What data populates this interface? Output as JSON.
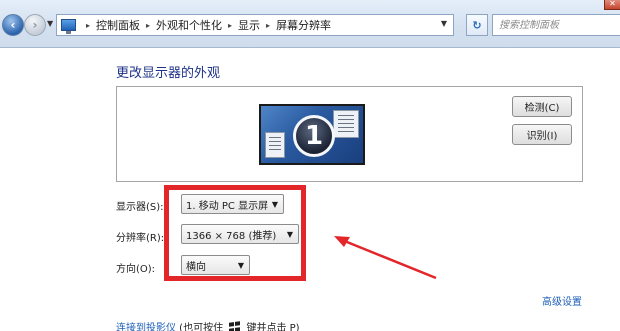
{
  "window": {
    "close_glyph": "✕"
  },
  "nav": {
    "back_glyph": "‹",
    "forward_glyph": "›",
    "dropdown_glyph": "▼"
  },
  "address_bar": {
    "icon": "control-panel-icon",
    "breadcrumbs": [
      {
        "label": "控制面板"
      },
      {
        "label": "外观和个性化"
      },
      {
        "label": "显示"
      },
      {
        "label": "屏幕分辨率"
      }
    ],
    "separator_glyph": "▸",
    "dropdown_glyph": "▼",
    "refresh_glyph": "↻"
  },
  "search": {
    "placeholder": "搜索控制面板"
  },
  "main": {
    "title": "更改显示器的外观",
    "monitor_number": "1",
    "detect_button": "检测(C)",
    "identify_button": "识别(I)",
    "display_label": "显示器(S):",
    "display_value": "1. 移动 PC 显示屏",
    "resolution_label": "分辨率(R):",
    "resolution_value": "1366 × 768 (推荐)",
    "orientation_label": "方向(O):",
    "orientation_value": "横向",
    "combo_arrow": "▼",
    "advanced_link": "高级设置",
    "projector_link": "连接到投影仪",
    "projector_hint_prefix": " (也可按住 ",
    "projector_hint_suffix": " 键并点击 P)"
  },
  "annotation": {
    "highlight_color": "#e3262a"
  }
}
